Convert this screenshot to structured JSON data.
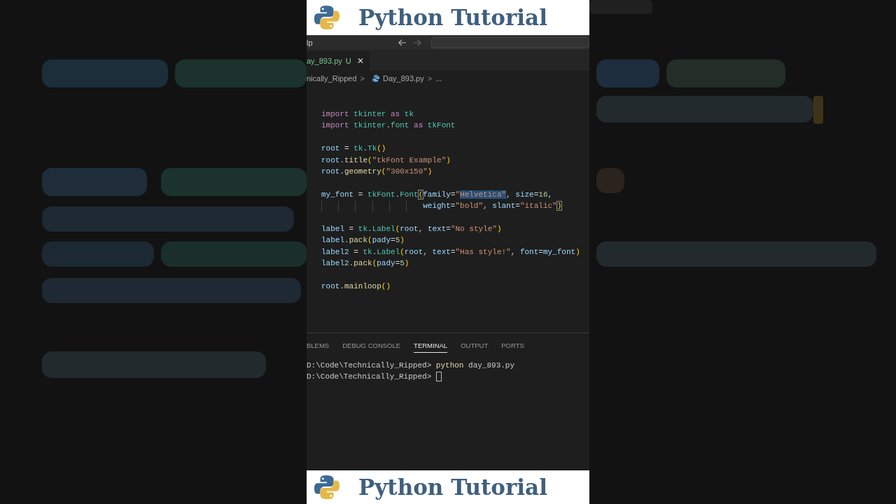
{
  "banner_top": {
    "title": "Python Tutorial"
  },
  "title_bar": {
    "menu_fragment": "lp"
  },
  "editor_tab": {
    "label": "ay_893.py",
    "badge": "U",
    "close": "✕",
    "selected": true
  },
  "breadcrumb": {
    "items": [
      "nically_Ripped",
      "Day_893.py",
      "..."
    ],
    "separators": [
      ">",
      ">"
    ]
  },
  "code": [
    {
      "gap_before": false,
      "continuation": false,
      "tokens": [
        {
          "t": "import",
          "kind": "kw"
        },
        {
          "t": " tkinter",
          "kind": "mod"
        },
        {
          "t": " as",
          "kind": "kw"
        },
        {
          "t": " tk",
          "kind": "mod"
        }
      ]
    },
    {
      "gap_before": false,
      "continuation": false,
      "tokens": [
        {
          "t": "import",
          "kind": "kw"
        },
        {
          "t": " tkinter",
          "kind": "mod"
        },
        {
          "t": "."
        },
        {
          "t": "font",
          "kind": "mod"
        },
        {
          "t": " as",
          "kind": "kw"
        },
        {
          "t": " tkFont",
          "kind": "mod"
        }
      ]
    },
    {
      "gap_before": true,
      "continuation": false,
      "tokens": [
        {
          "t": "root",
          "kind": "var"
        },
        {
          "t": " = "
        },
        {
          "t": "tk",
          "kind": "mod"
        },
        {
          "t": "."
        },
        {
          "t": "Tk",
          "kind": "mod"
        },
        {
          "t": "()",
          "kind": "br"
        }
      ]
    },
    {
      "gap_before": false,
      "continuation": false,
      "tokens": [
        {
          "t": "root",
          "kind": "var"
        },
        {
          "t": "."
        },
        {
          "t": "title",
          "kind": "fn"
        },
        {
          "t": "(",
          "kind": "br"
        },
        {
          "t": "\"tkFont Example\"",
          "kind": "str"
        },
        {
          "t": ")",
          "kind": "br"
        }
      ]
    },
    {
      "gap_before": false,
      "continuation": false,
      "tokens": [
        {
          "t": "root",
          "kind": "var"
        },
        {
          "t": "."
        },
        {
          "t": "geometry",
          "kind": "fn"
        },
        {
          "t": "(",
          "kind": "br"
        },
        {
          "t": "\"300x150\"",
          "kind": "str"
        },
        {
          "t": ")",
          "kind": "br"
        }
      ]
    },
    {
      "gap_before": true,
      "continuation": false,
      "tokens": [
        {
          "t": "my_font",
          "kind": "var"
        },
        {
          "t": " = "
        },
        {
          "t": "tkFont",
          "kind": "mod"
        },
        {
          "t": "."
        },
        {
          "t": "Font",
          "kind": "mod"
        },
        {
          "t": "(",
          "kind": "br",
          "matched": true
        },
        {
          "t": "family",
          "kind": "var"
        },
        {
          "t": "="
        },
        {
          "t": "\"",
          "kind": "str"
        },
        {
          "t": "Helvetica\"",
          "kind": "str",
          "selected": true
        },
        {
          "t": ", "
        },
        {
          "t": "size",
          "kind": "var"
        },
        {
          "t": "="
        },
        {
          "t": "16",
          "kind": "num"
        },
        {
          "t": ","
        }
      ]
    },
    {
      "gap_before": false,
      "continuation": true,
      "tokens": [
        {
          "t": "weight",
          "kind": "var"
        },
        {
          "t": "="
        },
        {
          "t": "\"bold\"",
          "kind": "str"
        },
        {
          "t": ", "
        },
        {
          "t": "slant",
          "kind": "var"
        },
        {
          "t": "="
        },
        {
          "t": "\"italic\"",
          "kind": "str"
        },
        {
          "t": ")",
          "kind": "br",
          "matched": true
        }
      ]
    },
    {
      "gap_before": true,
      "continuation": false,
      "tokens": [
        {
          "t": "label",
          "kind": "var"
        },
        {
          "t": " = "
        },
        {
          "t": "tk",
          "kind": "mod"
        },
        {
          "t": "."
        },
        {
          "t": "Label",
          "kind": "mod"
        },
        {
          "t": "(",
          "kind": "br"
        },
        {
          "t": "root",
          "kind": "var"
        },
        {
          "t": ", "
        },
        {
          "t": "text",
          "kind": "var"
        },
        {
          "t": "="
        },
        {
          "t": "\"No style\"",
          "kind": "str"
        },
        {
          "t": ")",
          "kind": "br"
        }
      ]
    },
    {
      "gap_before": false,
      "continuation": false,
      "tokens": [
        {
          "t": "label",
          "kind": "var"
        },
        {
          "t": "."
        },
        {
          "t": "pack",
          "kind": "fn"
        },
        {
          "t": "(",
          "kind": "br"
        },
        {
          "t": "pady",
          "kind": "var"
        },
        {
          "t": "="
        },
        {
          "t": "5",
          "kind": "num"
        },
        {
          "t": ")",
          "kind": "br"
        }
      ]
    },
    {
      "gap_before": false,
      "continuation": false,
      "tokens": [
        {
          "t": "label2",
          "kind": "var"
        },
        {
          "t": " = "
        },
        {
          "t": "tk",
          "kind": "mod"
        },
        {
          "t": "."
        },
        {
          "t": "Label",
          "kind": "mod"
        },
        {
          "t": "(",
          "kind": "br"
        },
        {
          "t": "root",
          "kind": "var"
        },
        {
          "t": ", "
        },
        {
          "t": "text",
          "kind": "var"
        },
        {
          "t": "="
        },
        {
          "t": "\"Has style!\"",
          "kind": "str"
        },
        {
          "t": ", "
        },
        {
          "t": "font",
          "kind": "var"
        },
        {
          "t": "="
        },
        {
          "t": "my_font",
          "kind": "var"
        },
        {
          "t": ")",
          "kind": "br"
        }
      ]
    },
    {
      "gap_before": false,
      "continuation": false,
      "tokens": [
        {
          "t": "label2",
          "kind": "var"
        },
        {
          "t": "."
        },
        {
          "t": "pack",
          "kind": "fn"
        },
        {
          "t": "(",
          "kind": "br"
        },
        {
          "t": "pady",
          "kind": "var"
        },
        {
          "t": "="
        },
        {
          "t": "5",
          "kind": "num"
        },
        {
          "t": ")",
          "kind": "br"
        }
      ]
    },
    {
      "gap_before": true,
      "continuation": false,
      "tokens": [
        {
          "t": "root",
          "kind": "var"
        },
        {
          "t": "."
        },
        {
          "t": "mainloop",
          "kind": "fn"
        },
        {
          "t": "()",
          "kind": "br"
        }
      ]
    }
  ],
  "panel_tabs": [
    {
      "label": "BLEMS",
      "selected": false
    },
    {
      "label": "DEBUG CONSOLE",
      "selected": false
    },
    {
      "label": "TERMINAL",
      "selected": true
    },
    {
      "label": "OUTPUT",
      "selected": false
    },
    {
      "label": "PORTS",
      "selected": false
    }
  ],
  "terminal": [
    {
      "prompt": "D:\\Code\\Technically_Ripped>",
      "command": "python",
      "args": "day_893.py"
    },
    {
      "prompt": "D:\\Code\\Technically_Ripped>"
    }
  ],
  "banner_bottom": {
    "title": "Python Tutorial"
  }
}
